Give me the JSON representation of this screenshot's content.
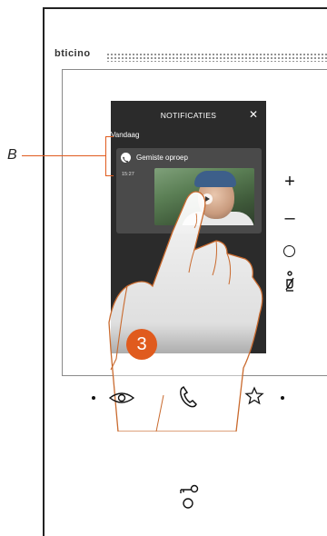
{
  "device": {
    "brand": "bticino"
  },
  "screen": {
    "title": "NOTIFICATIES",
    "close_icon": "close-icon",
    "section_label": "Vandaag",
    "notification": {
      "icon": "phone-icon",
      "title": "Gemiste oproep",
      "time": "15:27"
    }
  },
  "callout": {
    "label": "B",
    "color": "#e05b1e"
  },
  "step": {
    "number": "3",
    "color": "#e05b1e"
  },
  "side_buttons": {
    "plus": "+",
    "minus": "–"
  },
  "icons": [
    "plus-icon",
    "minus-icon",
    "answer-ring-icon",
    "mic-mute-icon",
    "eye-icon",
    "handset-icon",
    "star-icon",
    "key-icon"
  ]
}
